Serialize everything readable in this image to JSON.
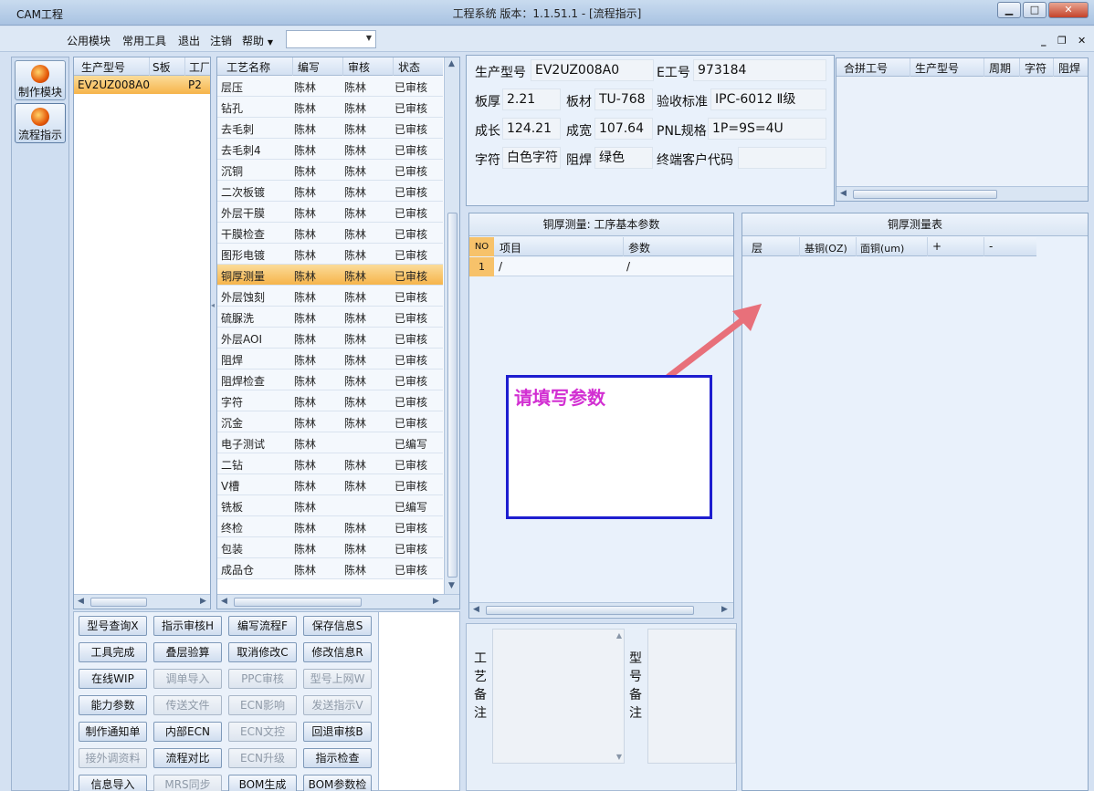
{
  "window": {
    "title": "工程系统   版本：1.1.51.1 - [流程指示]",
    "min": "▁",
    "max": "□",
    "close": "✕"
  },
  "menu": [
    "CAM工程",
    "公用模块",
    "常用工具",
    "退出",
    "注销",
    "帮助"
  ],
  "mdi_controls": {
    "min": "_",
    "restore": "❐",
    "close": "✕"
  },
  "nav": [
    {
      "label": "制作模块",
      "icon": "red-circle-icon"
    },
    {
      "label": "流程指示",
      "icon": "orange-circle-icon"
    }
  ],
  "models": {
    "headers": [
      "生产型号",
      "S板",
      "工厂"
    ],
    "rows": [
      {
        "model": "EV2UZ008A0",
        "plant": "P2"
      }
    ]
  },
  "process": {
    "headers": [
      "工艺名称",
      "编写",
      "审核",
      "状态"
    ],
    "selected": "铜厚测量",
    "rows": [
      {
        "name": "层压",
        "author": "陈林",
        "reviewer": "陈林",
        "status": "已审核"
      },
      {
        "name": "钻孔",
        "author": "陈林",
        "reviewer": "陈林",
        "status": "已审核"
      },
      {
        "name": "去毛刺",
        "author": "陈林",
        "reviewer": "陈林",
        "status": "已审核"
      },
      {
        "name": "去毛刺4",
        "author": "陈林",
        "reviewer": "陈林",
        "status": "已审核"
      },
      {
        "name": "沉铜",
        "author": "陈林",
        "reviewer": "陈林",
        "status": "已审核"
      },
      {
        "name": "二次板镀",
        "author": "陈林",
        "reviewer": "陈林",
        "status": "已审核"
      },
      {
        "name": "外层干膜",
        "author": "陈林",
        "reviewer": "陈林",
        "status": "已审核"
      },
      {
        "name": "干膜检查",
        "author": "陈林",
        "reviewer": "陈林",
        "status": "已审核"
      },
      {
        "name": "图形电镀",
        "author": "陈林",
        "reviewer": "陈林",
        "status": "已审核"
      },
      {
        "name": "铜厚测量",
        "author": "陈林",
        "reviewer": "陈林",
        "status": "已审核"
      },
      {
        "name": "外层蚀刻",
        "author": "陈林",
        "reviewer": "陈林",
        "status": "已审核"
      },
      {
        "name": "硫脲洗",
        "author": "陈林",
        "reviewer": "陈林",
        "status": "已审核"
      },
      {
        "name": "外层AOI",
        "author": "陈林",
        "reviewer": "陈林",
        "status": "已审核"
      },
      {
        "name": "阻焊",
        "author": "陈林",
        "reviewer": "陈林",
        "status": "已审核"
      },
      {
        "name": "阻焊检查",
        "author": "陈林",
        "reviewer": "陈林",
        "status": "已审核"
      },
      {
        "name": "字符",
        "author": "陈林",
        "reviewer": "陈林",
        "status": "已审核"
      },
      {
        "name": "沉金",
        "author": "陈林",
        "reviewer": "陈林",
        "status": "已审核"
      },
      {
        "name": "电子测试",
        "author": "陈林",
        "reviewer": "",
        "status": "已编写"
      },
      {
        "name": "二钻",
        "author": "陈林",
        "reviewer": "陈林",
        "status": "已审核"
      },
      {
        "name": "V槽",
        "author": "陈林",
        "reviewer": "陈林",
        "status": "已审核"
      },
      {
        "name": "铣板",
        "author": "陈林",
        "reviewer": "",
        "status": "已编写"
      },
      {
        "name": "终检",
        "author": "陈林",
        "reviewer": "陈林",
        "status": "已审核"
      },
      {
        "name": "包装",
        "author": "陈林",
        "reviewer": "陈林",
        "status": "已审核"
      },
      {
        "name": "成品仓",
        "author": "陈林",
        "reviewer": "陈林",
        "status": "已审核"
      }
    ]
  },
  "info": {
    "model_label": "生产型号",
    "model": "EV2UZ008A0",
    "e_label": "E工号",
    "e_no": "973184",
    "thick_label": "板厚",
    "thick": "2.21",
    "mat_label": "板材",
    "mat": "TU-768",
    "std_label": "验收标准",
    "std": "IPC-6012 Ⅱ级",
    "len_label": "成长",
    "len": "124.21",
    "wid_label": "成宽",
    "wid": "107.64",
    "pnl_label": "PNL规格",
    "pnl": "1P=9S=4U",
    "char_label": "字符",
    "char": "白色字符",
    "mask_label": "阻焊",
    "mask": "绿色",
    "cust_label": "终端客户代码",
    "cust": ""
  },
  "combine": {
    "headers": [
      "合拼工号",
      "生产型号",
      "周期",
      "字符",
      "阻焊"
    ]
  },
  "params": {
    "title": "铜厚测量: 工序基本参数",
    "headers": [
      "NO",
      "项目",
      "参数"
    ],
    "rows": [
      {
        "no": "1",
        "item": "/",
        "value": "/"
      }
    ],
    "annotation": "请填写参数"
  },
  "measure": {
    "title": "铜厚测量表",
    "headers": [
      "层",
      "基铜(OZ)",
      "面铜(um)",
      "+",
      "-"
    ]
  },
  "buttons": [
    [
      {
        "label": "型号查询X",
        "on": true
      },
      {
        "label": "指示审核H",
        "on": true
      },
      {
        "label": "编写流程F",
        "on": true
      },
      {
        "label": "保存信息S",
        "on": true
      }
    ],
    [
      {
        "label": "工具完成",
        "on": true
      },
      {
        "label": "叠层验算",
        "on": true
      },
      {
        "label": "取消修改C",
        "on": true
      },
      {
        "label": "修改信息R",
        "on": true
      }
    ],
    [
      {
        "label": "在线WIP",
        "on": true
      },
      {
        "label": "调单导入",
        "on": false
      },
      {
        "label": "PPC审核",
        "on": false
      },
      {
        "label": "型号上网W",
        "on": false
      }
    ],
    [
      {
        "label": "能力参数",
        "on": true
      },
      {
        "label": "传送文件",
        "on": false
      },
      {
        "label": "ECN影响",
        "on": false
      },
      {
        "label": "发送指示V",
        "on": false
      }
    ],
    [
      {
        "label": "制作通知单",
        "on": true
      },
      {
        "label": "内部ECN",
        "on": true
      },
      {
        "label": "ECN文控",
        "on": false
      },
      {
        "label": "回退审核B",
        "on": true
      }
    ],
    [
      {
        "label": "接外调资料",
        "on": false
      },
      {
        "label": "流程对比",
        "on": true
      },
      {
        "label": "ECN升级",
        "on": false
      },
      {
        "label": "指示检查",
        "on": true
      }
    ],
    [
      {
        "label": "信息导入",
        "on": true
      },
      {
        "label": "MRS同步",
        "on": false
      },
      {
        "label": "BOM生成",
        "on": true
      },
      {
        "label": "BOM参数检查",
        "on": true
      }
    ]
  ],
  "remarks": {
    "craft": "工艺备注",
    "model": "型号备注"
  }
}
